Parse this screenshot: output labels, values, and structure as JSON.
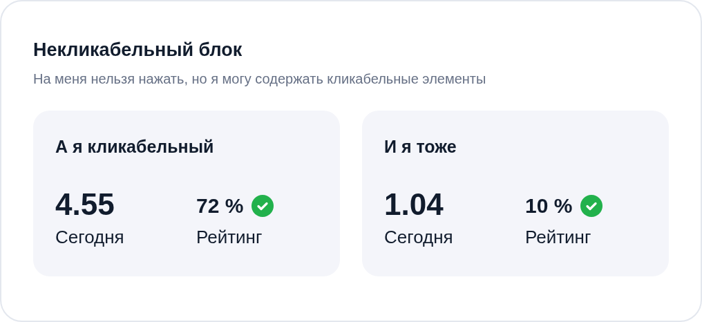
{
  "block": {
    "title": "Некликабельный блок",
    "subtitle": "На меня нельзя нажать, но я могу содержать кликабельные элементы"
  },
  "cards": [
    {
      "title": "А я кликабельный",
      "value": "4.55",
      "value_label": "Сегодня",
      "rating": "72 %",
      "verified": true,
      "rating_label": "Рейтинг"
    },
    {
      "title": "И я тоже",
      "value": "1.04",
      "value_label": "Сегодня",
      "rating": "10 %",
      "verified": true,
      "rating_label": "Рейтинг"
    }
  ]
}
